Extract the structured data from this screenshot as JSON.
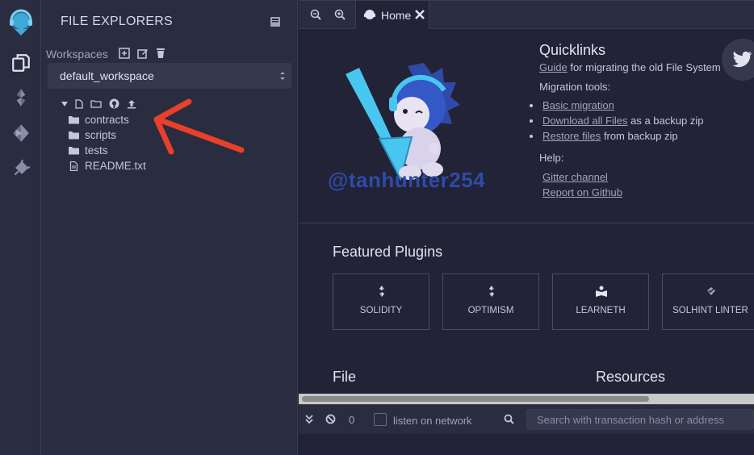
{
  "sidebar": {
    "title": "FILE EXPLORERS",
    "workspaces_label": "Workspaces",
    "workspace_selected": "default_workspace",
    "tree": [
      "contracts",
      "scripts",
      "tests",
      "README.txt"
    ],
    "icons": [
      "remix-logo-icon",
      "file-explorer-icon",
      "solidity-compiler-icon",
      "deploy-run-icon",
      "plugin-manager-icon"
    ]
  },
  "tabs": {
    "home_label": "Home"
  },
  "home": {
    "quicklinks_title": "Quicklinks",
    "guide_link": "Guide",
    "guide_text": "for migrating the old File System",
    "migration_title": "Migration tools:",
    "basic_migration": "Basic migration",
    "download_all": "Download all Files",
    "download_suffix": "as a backup zip",
    "restore_files": "Restore files",
    "restore_suffix": "from backup zip",
    "help_title": "Help:",
    "gitter": "Gitter channel",
    "github": "Report on Github",
    "watermark": "@tanhunter254",
    "featured_title": "Featured Plugins",
    "plugins": [
      "SOLIDITY",
      "OPTIMISM",
      "LEARNETH",
      "SOLHINT LINTER"
    ],
    "file_title": "File",
    "resources_title": "Resources"
  },
  "terminal": {
    "count": "0",
    "listen_label": "listen on network",
    "search_placeholder": "Search with transaction hash or address"
  },
  "colors": {
    "accent": "#2aa6dc",
    "annotation_arrow": "#e8402a"
  }
}
